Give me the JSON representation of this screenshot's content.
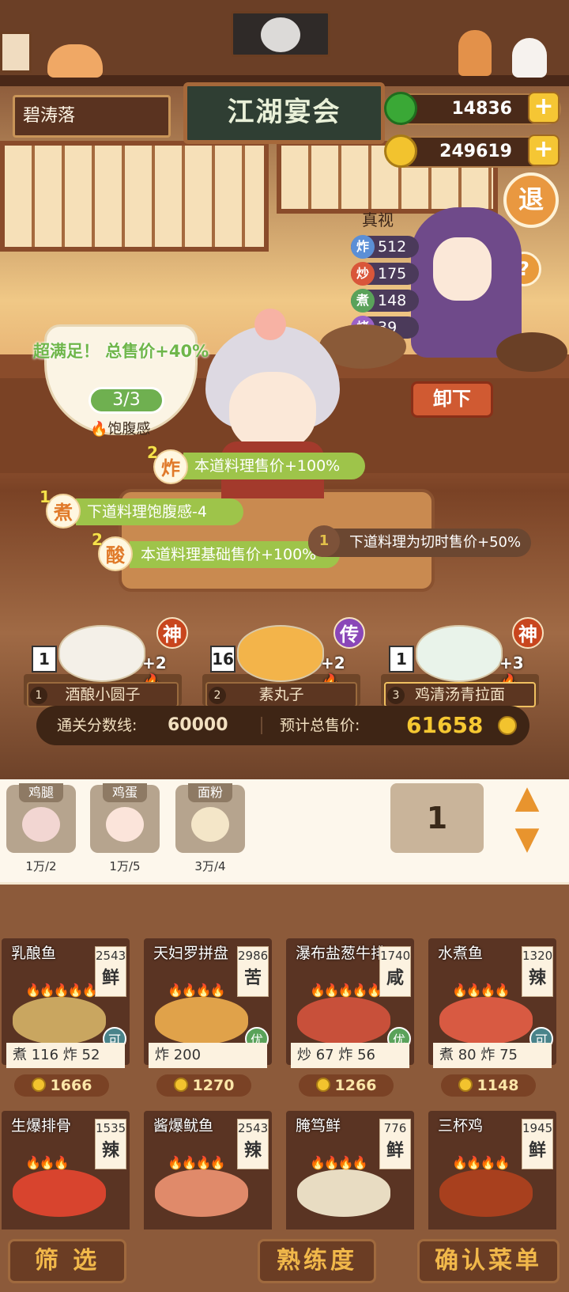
{
  "header": {
    "player_name": "碧涛落",
    "event_title": "江湖宴会",
    "jade_amount": "14836",
    "coin_amount": "249619",
    "plus_symbol": "+",
    "exit_label": "退",
    "help_label": "?"
  },
  "chef": {
    "name": "真视",
    "stats": [
      {
        "glyph": "炸",
        "value": "512",
        "color": "#5b8fd6"
      },
      {
        "glyph": "炒",
        "value": "175",
        "color": "#d9563a"
      },
      {
        "glyph": "煮",
        "value": "148",
        "color": "#5aa25a"
      },
      {
        "glyph": "烤",
        "value": "39",
        "color": "#9b62c8"
      }
    ],
    "unload_label": "卸下"
  },
  "customer": {
    "satisfy_text": "超满足！ 总售价+40%",
    "fullness_fraction": "3/3",
    "fullness_label": "饱腹感",
    "fullness_icon": "flame-icon"
  },
  "bonuses": [
    {
      "num": "2",
      "glyph": "炸",
      "text": "本道料理售价+100%"
    },
    {
      "num": "1",
      "glyph": "煮",
      "text": "下道料理饱腹感-4"
    },
    {
      "num": "2",
      "glyph": "酸",
      "text": "本道料理基础售价+100%"
    }
  ],
  "dark_bonus": {
    "num": "1",
    "text": "下道料理为切时售价+50%"
  },
  "slots": [
    {
      "index": "1",
      "count": "1",
      "plus": "+2",
      "name": "酒酿小圆子",
      "grade": "神",
      "grade_color": "#c8461e"
    },
    {
      "index": "2",
      "count": "16",
      "plus": "+2",
      "name": "素丸子",
      "grade": "传",
      "grade_color": "#8a47b8"
    },
    {
      "index": "3",
      "count": "1",
      "plus": "+3",
      "name": "鸡清汤青拉面",
      "grade": "神",
      "grade_color": "#c8461e"
    }
  ],
  "score": {
    "threshold_label": "通关分数线:",
    "threshold_value": "60000",
    "estimate_label": "预计总售价:",
    "estimate_value": "61658"
  },
  "ingredients": [
    {
      "name": "鸡腿",
      "qty": "1万/2"
    },
    {
      "name": "鸡蛋",
      "qty": "1万/5"
    },
    {
      "name": "面粉",
      "qty": "3万/4"
    }
  ],
  "quantity": "1",
  "quantity_up": "▲",
  "quantity_down": "▼",
  "menu": [
    {
      "name": "乳酿鱼",
      "price": "2543",
      "taste": "鲜",
      "flames": "🔥🔥🔥🔥🔥",
      "stats": "煮 116  炸 52",
      "sale": "1666",
      "tag": "可"
    },
    {
      "name": "天妇罗拼盘",
      "price": "2986",
      "taste": "苦",
      "flames": "🔥🔥🔥🔥",
      "stats": "炸 200",
      "sale": "1270",
      "tag": "优"
    },
    {
      "name": "瀑布盐葱牛排",
      "price": "1740",
      "taste": "咸",
      "flames": "🔥🔥🔥🔥🔥",
      "stats": "炒 67  炸 56",
      "sale": "1266",
      "tag": "优"
    },
    {
      "name": "水煮鱼",
      "price": "1320",
      "taste": "辣",
      "flames": "🔥🔥🔥🔥",
      "stats": "煮 80  炸 75",
      "sale": "1148",
      "tag": "可"
    },
    {
      "name": "生爆排骨",
      "price": "1535",
      "taste": "辣",
      "flames": "🔥🔥🔥",
      "stats": "",
      "sale": "",
      "tag": ""
    },
    {
      "name": "酱爆鱿鱼",
      "price": "2543",
      "taste": "辣",
      "flames": "🔥🔥🔥🔥",
      "stats": "",
      "sale": "",
      "tag": ""
    },
    {
      "name": "腌笃鲜",
      "price": "776",
      "taste": "鲜",
      "flames": "🔥🔥🔥🔥",
      "stats": "",
      "sale": "",
      "tag": ""
    },
    {
      "name": "三杯鸡",
      "price": "1945",
      "taste": "鲜",
      "flames": "🔥🔥🔥🔥",
      "stats": "",
      "sale": "",
      "tag": ""
    }
  ],
  "bottom": {
    "filter": "筛 选",
    "proficiency": "熟练度",
    "confirm": "确认菜单"
  }
}
